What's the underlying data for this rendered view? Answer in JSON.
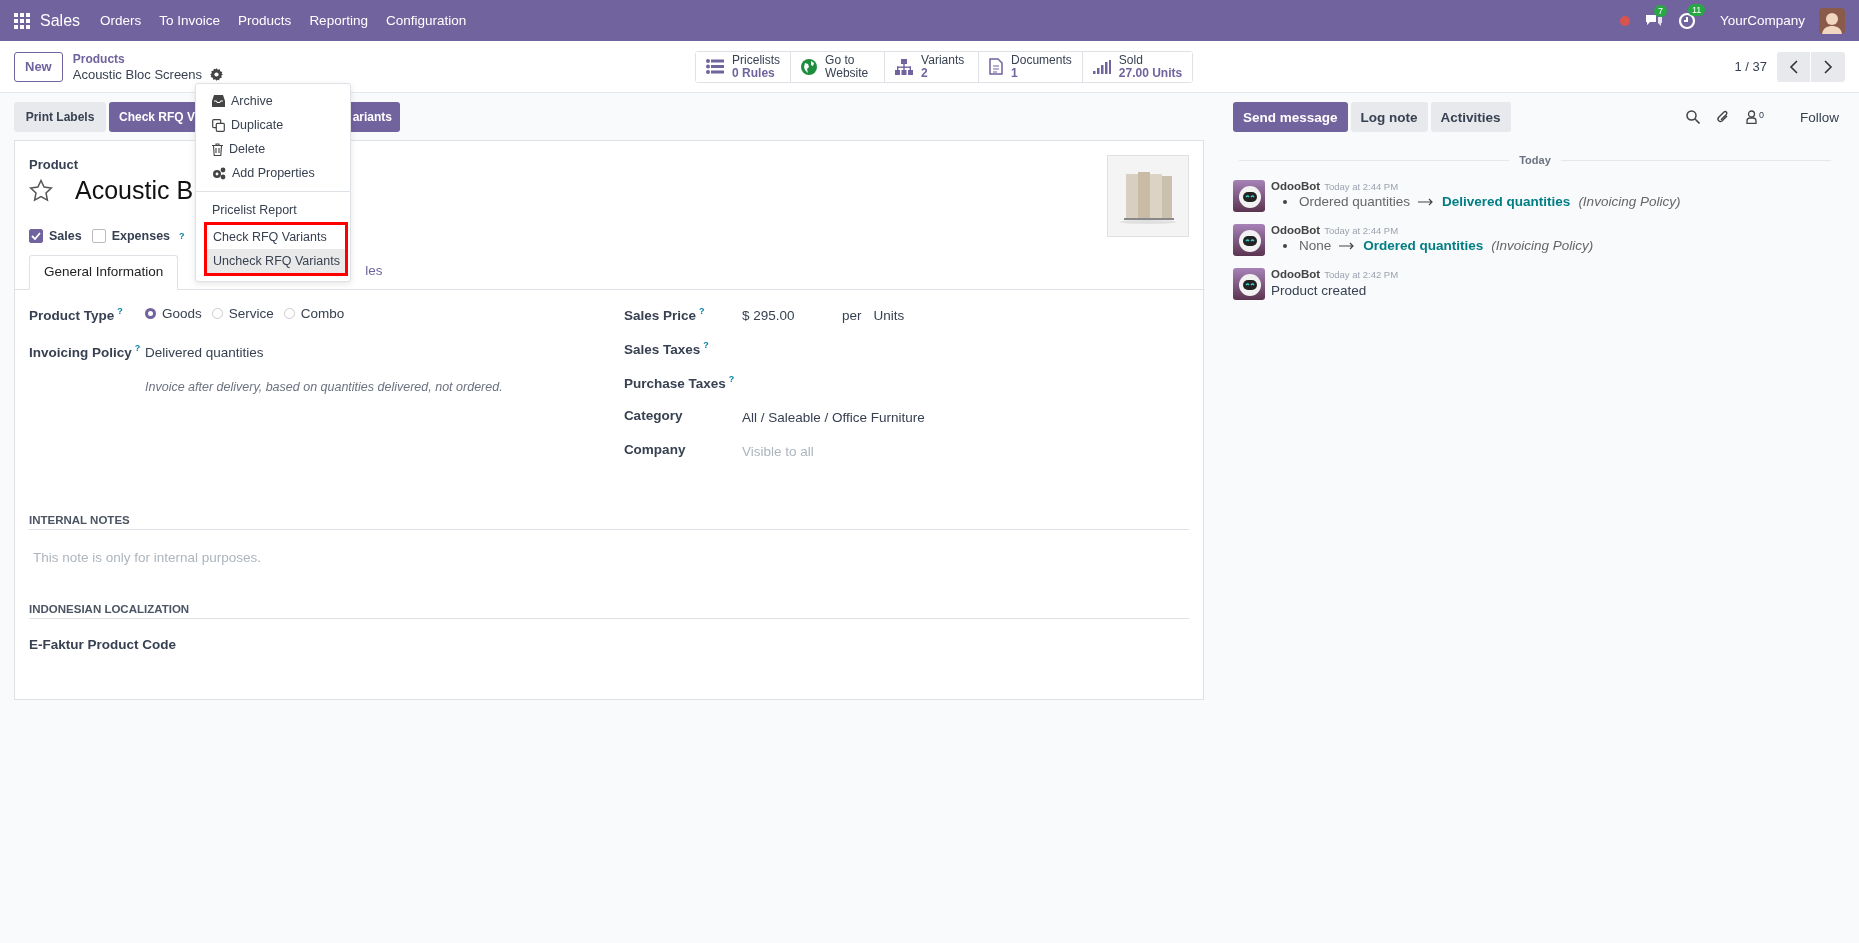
{
  "navbar": {
    "app": "Sales",
    "menus": [
      "Orders",
      "To Invoice",
      "Products",
      "Reporting",
      "Configuration"
    ],
    "messages_count": "7",
    "activities_count": "11",
    "company": "YourCompany"
  },
  "control_panel": {
    "new_button": "New",
    "breadcrumb_parent": "Products",
    "record_name": "Acoustic Bloc Screens",
    "smart_buttons": [
      {
        "kind": "list",
        "label": "Pricelists",
        "value": "0 Rules"
      },
      {
        "kind": "globe",
        "label": "Go to",
        "value": "Website"
      },
      {
        "kind": "tree",
        "label": "Variants",
        "value": "2"
      },
      {
        "kind": "document",
        "label": "Documents",
        "value": "1"
      },
      {
        "kind": "bars",
        "label": "Sold",
        "value": "27.00 Units"
      }
    ],
    "pager": "1 / 37"
  },
  "action_buttons": [
    {
      "label": "Print Labels",
      "primary": false
    },
    {
      "label": "Check RFQ V",
      "primary": true
    },
    {
      "label": "ariants",
      "primary": true
    }
  ],
  "gear_menu": {
    "groups": [
      [
        {
          "kind": "archive",
          "label": "Archive",
          "hovered": false,
          "highlighted": false
        },
        {
          "kind": "copy",
          "label": "Duplicate",
          "hovered": false,
          "highlighted": false
        },
        {
          "kind": "trash",
          "label": "Delete",
          "hovered": false,
          "highlighted": false
        },
        {
          "kind": "gears",
          "label": "Add Properties",
          "hovered": false,
          "highlighted": false
        }
      ],
      [
        {
          "label": "Pricelist Report",
          "hovered": false,
          "highlighted": false
        },
        {
          "label": "Check RFQ Variants",
          "hovered": false,
          "highlighted": true
        },
        {
          "label": "Uncheck RFQ Variants",
          "hovered": true,
          "highlighted": true
        }
      ]
    ]
  },
  "sheet": {
    "label": "Product",
    "title": "Acoustic B",
    "starred": false,
    "options": [
      {
        "label": "Sales",
        "checked": true
      },
      {
        "label": "Expenses",
        "checked": false,
        "help": "?"
      }
    ],
    "tabs": [
      {
        "label": "General Information",
        "selected": true
      },
      {
        "label": "les",
        "selected": false
      }
    ],
    "left_fields": [
      {
        "kind": "radio",
        "label": "Product Type",
        "help": "?",
        "options": [
          {
            "label": "Goods",
            "selected": true
          },
          {
            "label": "Service",
            "selected": false
          },
          {
            "label": "Combo",
            "selected": false
          }
        ]
      },
      {
        "kind": "text",
        "label": "Invoicing Policy",
        "help": "?",
        "value": "Delivered quantities",
        "note": "Invoice after delivery, based on quantities delivered, not ordered."
      }
    ],
    "right_fields": [
      {
        "kind": "price",
        "label": "Sales Price",
        "help": "?",
        "value": "$ 295.00",
        "per": "per",
        "unit": "Units"
      },
      {
        "kind": "empty",
        "label": "Sales Taxes",
        "help": "?"
      },
      {
        "kind": "empty",
        "label": "Purchase Taxes",
        "help": "?"
      },
      {
        "kind": "text",
        "label": "Category",
        "value": "All / Saleable / Office Furniture"
      },
      {
        "kind": "placeholder",
        "label": "Company",
        "placeholder": "Visible to all"
      }
    ],
    "sections": [
      {
        "kind": "note",
        "title": "INTERNAL NOTES",
        "placeholder": "This note is only for internal purposes."
      },
      {
        "kind": "field",
        "title": "INDONESIAN LOCALIZATION",
        "field": "E-Faktur Product Code"
      }
    ]
  },
  "chatter": {
    "buttons": [
      {
        "label": "Send message",
        "primary": true
      },
      {
        "label": "Log note",
        "primary": false
      },
      {
        "label": "Activities",
        "primary": false
      }
    ],
    "followers": "0",
    "follow": "Follow",
    "separator": "Today",
    "messages": [
      {
        "kind": "tracking",
        "author": "OdooBot",
        "time": "Today at 2:44 PM",
        "old": "Ordered quantities",
        "new": "Delivered quantities",
        "field": "(Invoicing Policy)"
      },
      {
        "kind": "tracking",
        "author": "OdooBot",
        "time": "Today at 2:44 PM",
        "old": "None",
        "new": "Ordered quantities",
        "field": "(Invoicing Policy)"
      },
      {
        "kind": "text",
        "author": "OdooBot",
        "time": "Today at 2:42 PM",
        "body": "Product created"
      }
    ]
  }
}
